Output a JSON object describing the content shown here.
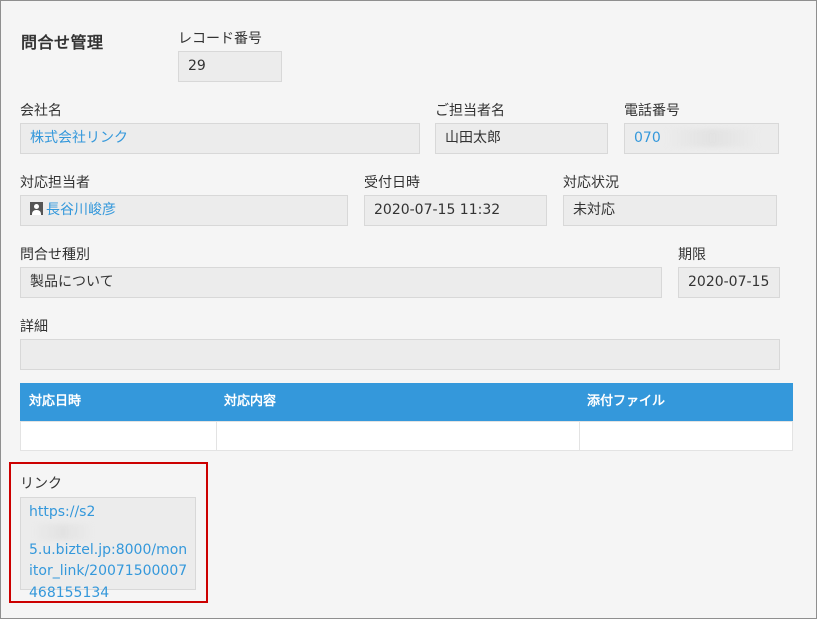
{
  "form": {
    "title": "問合せ管理",
    "record_number": {
      "label": "レコード番号",
      "value": "29"
    },
    "company": {
      "label": "会社名",
      "value": "株式会社リンク"
    },
    "contact_person": {
      "label": "ご担当者名",
      "value": "山田太郎"
    },
    "phone": {
      "label": "電話番号",
      "value": "070"
    },
    "assignee": {
      "label": "対応担当者",
      "value": "長谷川峻彦",
      "icon": "user-icon"
    },
    "received_at": {
      "label": "受付日時",
      "value": "2020-07-15 11:32"
    },
    "status": {
      "label": "対応状況",
      "value": "未対応"
    },
    "inquiry_type": {
      "label": "問合せ種別",
      "value": "製品について"
    },
    "deadline": {
      "label": "期限",
      "value": "2020-07-15"
    },
    "details": {
      "label": "詳細",
      "value": ""
    },
    "table": {
      "headers": [
        "対応日時",
        "対応内容",
        "添付ファイル"
      ]
    },
    "link": {
      "label": "リンク",
      "lines": [
        "https://s2",
        "5.u.biztel.jp:8000/mon",
        "itor_link/20071500007",
        "468155134"
      ]
    }
  },
  "colors": {
    "accent": "#3498db",
    "highlight_border": "#cc0000",
    "field_bg": "#ececec",
    "panel_bg": "#f5f5f5"
  }
}
